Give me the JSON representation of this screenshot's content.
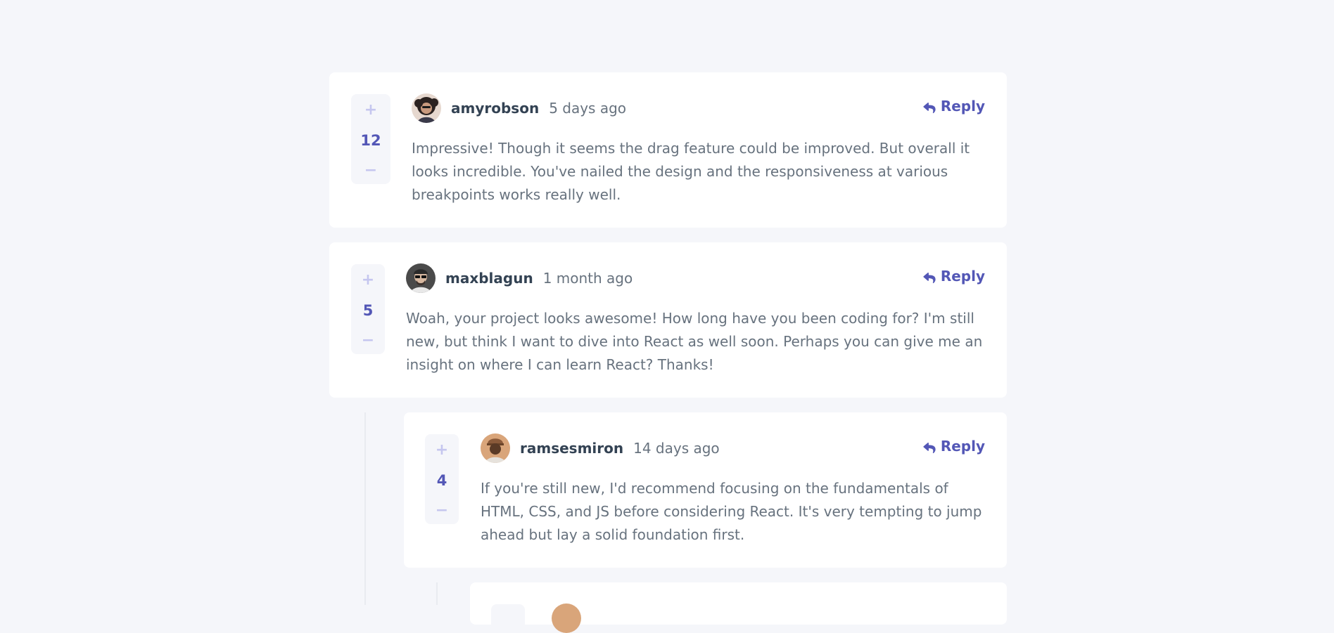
{
  "colors": {
    "page_background": "#f5f6fa",
    "card_background": "#ffffff",
    "accent": "#5357b6",
    "vote_button": "#c5c6ef",
    "username": "#334253",
    "body_text": "#67727e"
  },
  "comments": [
    {
      "score": "12",
      "upvote_icon": "plus-icon",
      "downvote_icon": "minus-icon",
      "upvote_label": "+",
      "downvote_label": "−",
      "avatar": "avatar-amyrobson",
      "username": "amyrobson",
      "created_at": "5 days ago",
      "reply_label": "Reply",
      "content": "Impressive! Though it seems the drag feature could be improved. But overall it looks incredible. You've nailed the design and the responsiveness at various breakpoints works really well."
    },
    {
      "score": "5",
      "upvote_label": "+",
      "downvote_label": "−",
      "avatar": "avatar-maxblagun",
      "username": "maxblagun",
      "created_at": "1 month ago",
      "reply_label": "Reply",
      "content": "Woah, your project looks awesome! How long have you been coding for? I'm still new, but think I want to dive into React as well soon. Perhaps you can give me an insight on where I can learn React? Thanks!"
    }
  ],
  "replies": [
    {
      "score": "4",
      "upvote_label": "+",
      "downvote_label": "−",
      "avatar": "avatar-ramsesmiron",
      "username": "ramsesmiron",
      "created_at": "14 days ago",
      "reply_label": "Reply",
      "content": "If you're still new, I'd recommend focusing on the fundamentals of HTML, CSS, and JS before considering React. It's very tempting to jump ahead but lay a solid foundation first."
    }
  ]
}
